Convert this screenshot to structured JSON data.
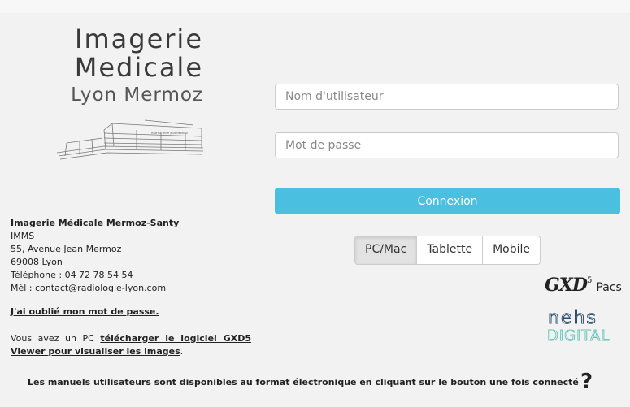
{
  "logo": {
    "line1": "Imagerie",
    "line2": "Medicale",
    "line3": "Lyon Mermoz"
  },
  "address": {
    "org": "Imagerie Médicale Mermoz-Santy",
    "abbr": "IMMS",
    "street": "55, Avenue Jean Mermoz",
    "city": "69008 Lyon",
    "phone": "Téléphone : 04 72 78 54 54",
    "email": "Mèl : contact@radiologie-lyon.com"
  },
  "forgot_password": "J'ai oublié mon mot de passe.",
  "download": {
    "prefix": "Vous avez un PC",
    "link": "télécharger le logiciel GXD5 Viewer pour visualiser les images",
    "suffix": "."
  },
  "login": {
    "username_placeholder": "Nom d'utilisateur",
    "password_placeholder": "Mot de passe",
    "submit_label": "Connexion"
  },
  "device_tabs": [
    {
      "label": "PC/Mac",
      "active": true
    },
    {
      "label": "Tablette",
      "active": false
    },
    {
      "label": "Mobile",
      "active": false
    }
  ],
  "brand": {
    "gxd": "GXD",
    "gxd_sup": "5",
    "pacs": "Pacs",
    "nehs": "nehs",
    "digital": "DIGITAL",
    "accent_color": "#4bbfe0"
  },
  "footer": {
    "manuals_text": "Les manuels utilisateurs sont disponibles au format électronique en cliquant sur le bouton une fois connecté",
    "help_icon": "?"
  }
}
